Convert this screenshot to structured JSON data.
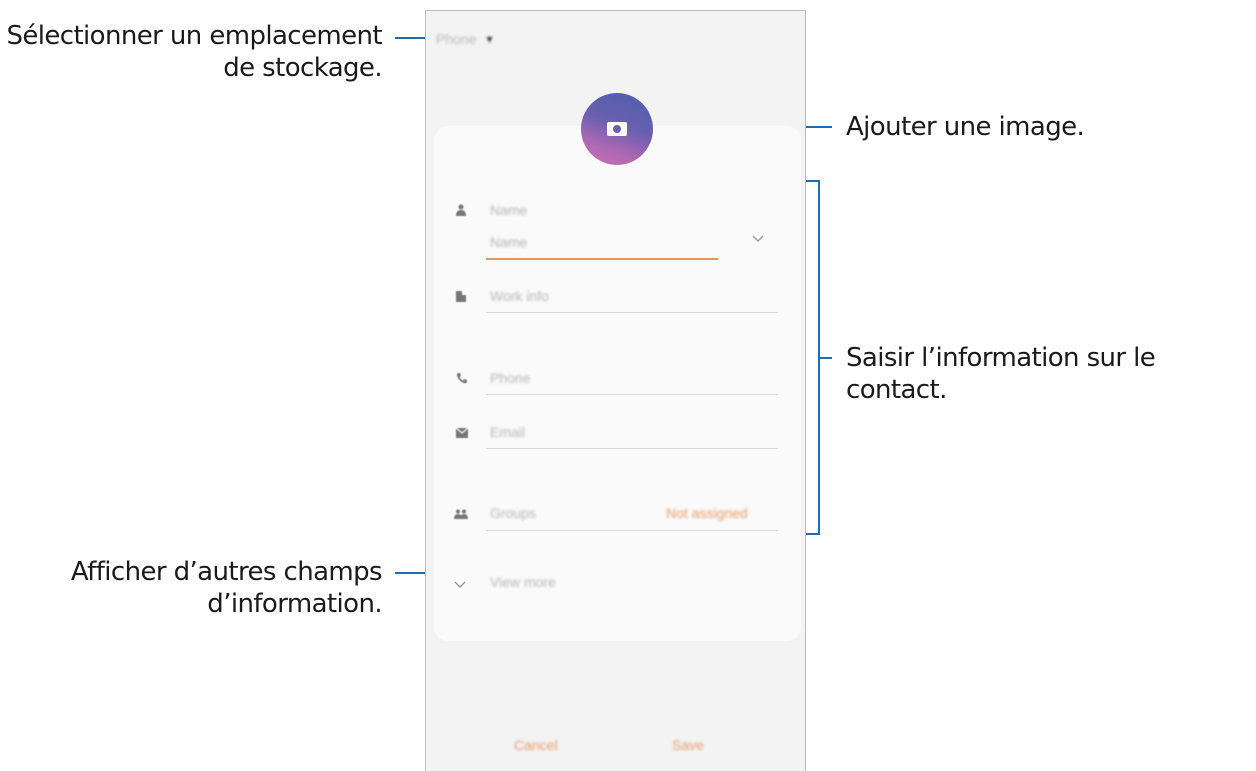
{
  "callouts": {
    "storage_line1": "Sélectionner un emplacement",
    "storage_line2": "de stockage.",
    "image": "Ajouter une image.",
    "contact_info": "Saisir l’information sur le contact.",
    "more_line1": "Afficher d’autres champs",
    "more_line2": "d’information."
  },
  "phone": {
    "storage_value": "Phone",
    "storage_caret": "▾",
    "name_label": "Name",
    "name_placeholder": "Name",
    "work_placeholder": "Work info",
    "phone_placeholder": "Phone",
    "email_placeholder": "Email",
    "groups_label": "Groups",
    "groups_value": "Not assigned",
    "view_more": "View more",
    "cancel": "Cancel",
    "save": "Save"
  },
  "icons": {
    "person": "person-icon",
    "work": "building-icon",
    "phone": "phone-icon",
    "email": "email-icon",
    "groups": "groups-icon",
    "camera": "camera-icon",
    "chevron": "chevron-down-icon"
  },
  "colors": {
    "callout_line": "#1a6fb4",
    "accent_orange": "#e69a66"
  }
}
